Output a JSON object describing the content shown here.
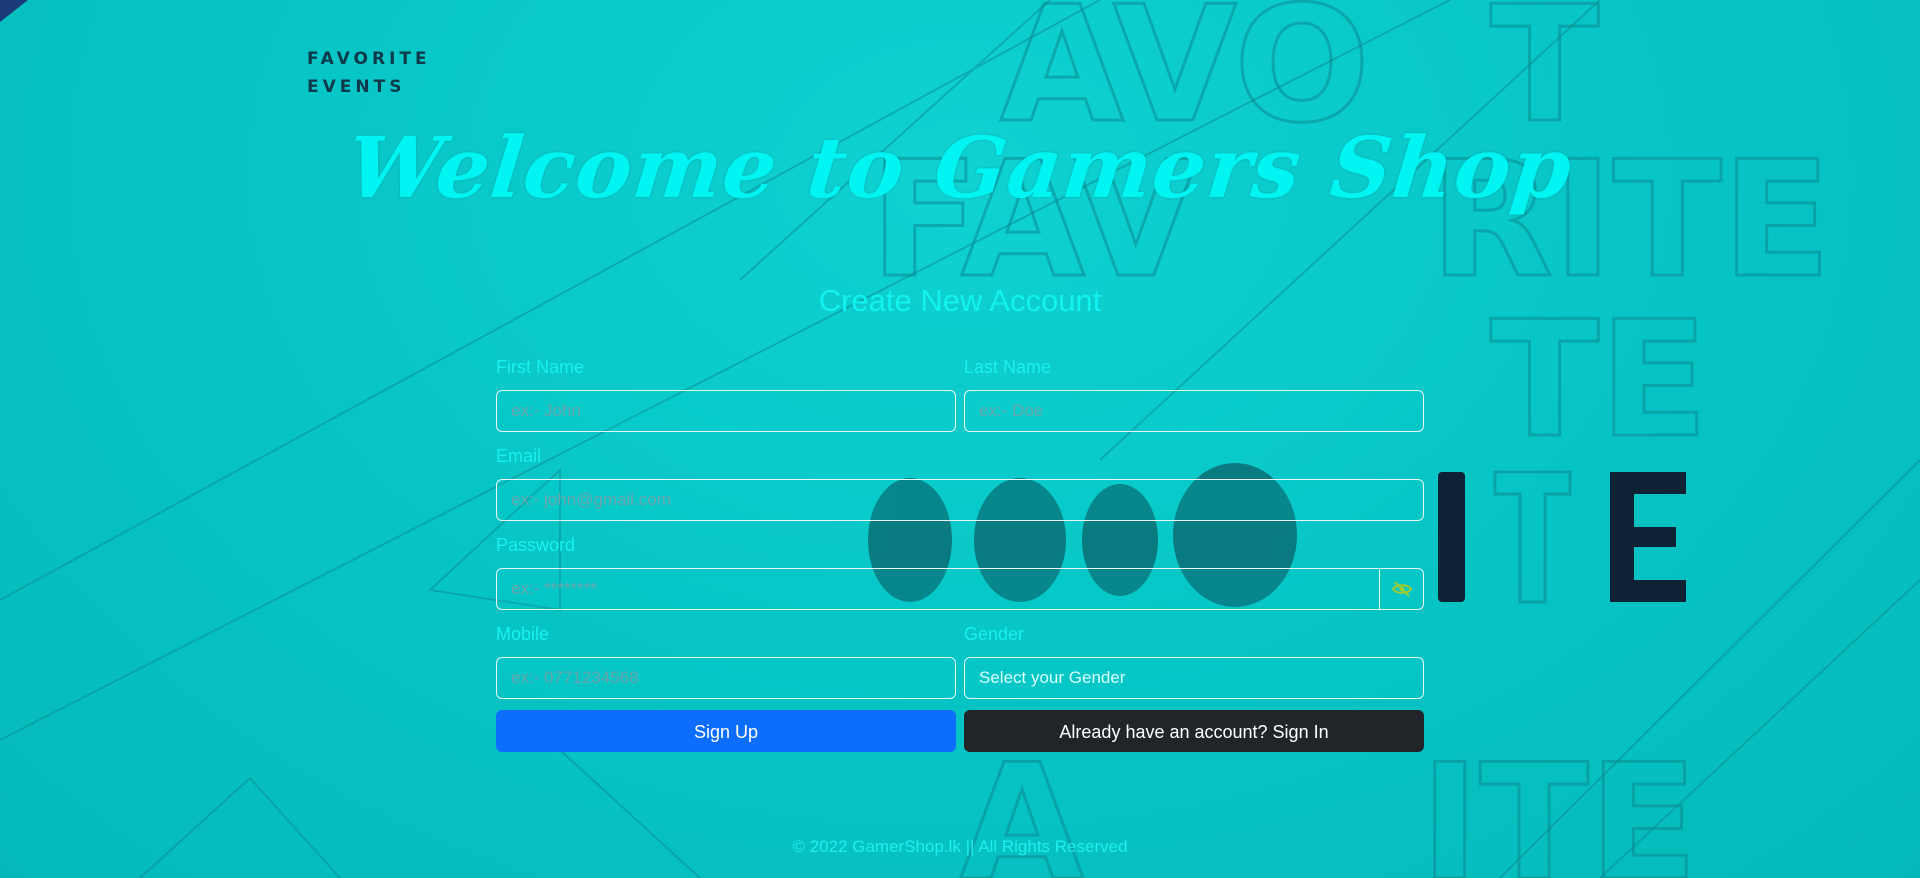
{
  "brand": {
    "line1": "FAVORITE",
    "line2": "EVENTS"
  },
  "hero": {
    "title": "Welcome to Gamers Shop"
  },
  "form": {
    "title": "Create New Account",
    "first_name": {
      "label": "First Name",
      "placeholder": "ex:- John"
    },
    "last_name": {
      "label": "Last Name",
      "placeholder": "ex:- Doe"
    },
    "email": {
      "label": "Email",
      "placeholder": "ex:- john@gmail.com"
    },
    "password": {
      "label": "Password",
      "placeholder": "ex:- ********"
    },
    "mobile": {
      "label": "Mobile",
      "placeholder": "ex:- 0771234568"
    },
    "gender": {
      "label": "Gender",
      "selected": "Select your Gender"
    },
    "signup_label": "Sign Up",
    "signin_label": "Already have an account? Sign In"
  },
  "footer": {
    "text": "© 2022 GamerShop.lk || All Rights Reserved"
  },
  "colors": {
    "background": "#00c9c8",
    "accent_text": "#12f3f0",
    "primary_button": "#0d6efd",
    "dark_button": "#212529",
    "eye_icon": "#9acd32"
  },
  "icons": {
    "password_toggle": "eye-slash-icon"
  }
}
